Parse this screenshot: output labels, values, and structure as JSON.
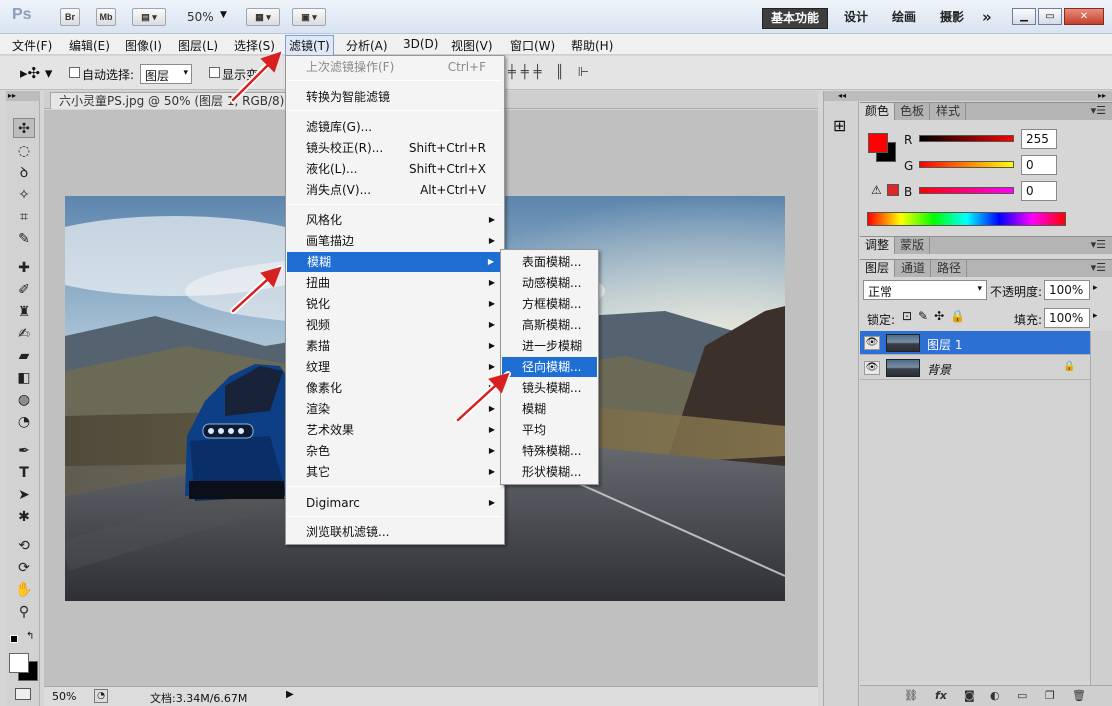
{
  "app": {
    "logo": "Ps",
    "bridge_btn": "Br",
    "minibridge_btn": "Mb",
    "zoom_level": "50%",
    "workspaces": [
      "基本功能",
      "设计",
      "绘画",
      "摄影"
    ],
    "more": "»"
  },
  "menubar": [
    "文件(F)",
    "编辑(E)",
    "图像(I)",
    "图层(L)",
    "选择(S)",
    "滤镜(T)",
    "分析(A)",
    "3D(D)",
    "视图(V)",
    "窗口(W)",
    "帮助(H)"
  ],
  "options": {
    "auto_select_label": "自动选择:",
    "auto_select_value": "图层",
    "show_transform_label": "显示变"
  },
  "document": {
    "tab_title": "六小灵童PS.jpg @ 50% (图层 1, RGB/8) *",
    "status_zoom": "50%",
    "status_doc": "文档:3.34M/6.67M"
  },
  "filter_menu": {
    "items": [
      {
        "label": "上次滤镜操作(F)",
        "shortcut": "Ctrl+F",
        "disabled": true
      },
      {
        "label": "转换为智能滤镜"
      },
      {
        "label": "滤镜库(G)..."
      },
      {
        "label": "镜头校正(R)...",
        "shortcut": "Shift+Ctrl+R"
      },
      {
        "label": "液化(L)...",
        "shortcut": "Shift+Ctrl+X"
      },
      {
        "label": "消失点(V)...",
        "shortcut": "Alt+Ctrl+V"
      },
      {
        "label": "风格化"
      },
      {
        "label": "画笔描边"
      },
      {
        "label": "模糊"
      },
      {
        "label": "扭曲"
      },
      {
        "label": "锐化"
      },
      {
        "label": "视频"
      },
      {
        "label": "素描"
      },
      {
        "label": "纹理"
      },
      {
        "label": "像素化"
      },
      {
        "label": "渲染"
      },
      {
        "label": "艺术效果"
      },
      {
        "label": "杂色"
      },
      {
        "label": "其它"
      },
      {
        "label": "Digimarc"
      },
      {
        "label": "浏览联机滤镜..."
      }
    ]
  },
  "blur_submenu": [
    "表面模糊...",
    "动感模糊...",
    "方框模糊...",
    "高斯模糊...",
    "进一步模糊",
    "径向模糊...",
    "镜头模糊...",
    "模糊",
    "平均",
    "特殊模糊...",
    "形状模糊..."
  ],
  "color_panel": {
    "tabs": [
      "颜色",
      "色板",
      "样式"
    ],
    "r_label": "R",
    "g_label": "G",
    "b_label": "B",
    "r_value": "255",
    "g_value": "0",
    "b_value": "0",
    "foreground": "#ff0000",
    "background": "#000000"
  },
  "adjust_panel": {
    "tabs": [
      "调整",
      "蒙版"
    ]
  },
  "layers_panel": {
    "tabs": [
      "图层",
      "通道",
      "路径"
    ],
    "blend_mode": "正常",
    "opacity_label": "不透明度:",
    "opacity_value": "100%",
    "lock_label": "锁定:",
    "fill_label": "填充:",
    "fill_value": "100%",
    "layers": [
      {
        "name": "图层 1",
        "selected": true
      },
      {
        "name": "背景",
        "locked": true
      }
    ]
  },
  "colors": {
    "highlight": "#1f6ed4",
    "annotation_arrow": "#d82020"
  }
}
